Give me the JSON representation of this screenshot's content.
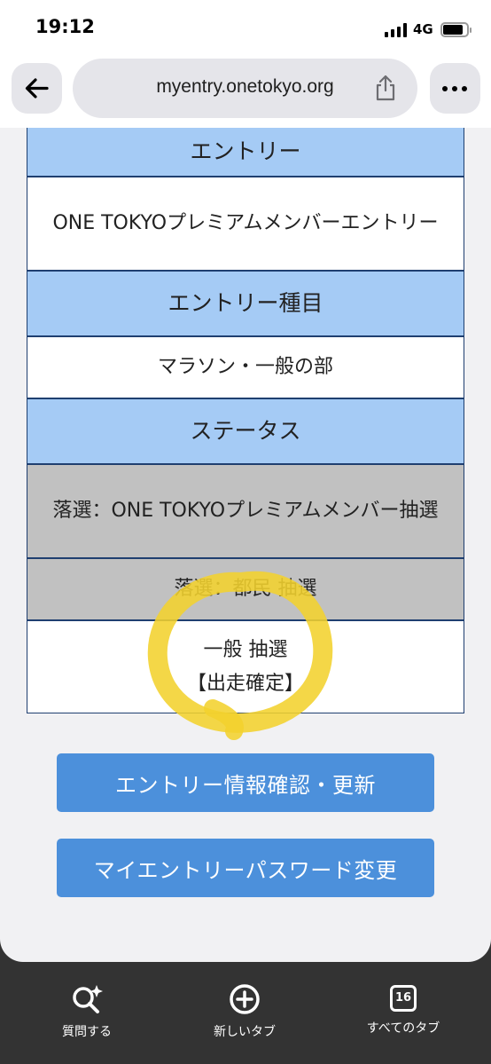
{
  "status_bar": {
    "time": "19:12",
    "network": "4G"
  },
  "browser": {
    "url": "myentry.onetokyo.org",
    "icons": [
      "back-arrow-icon",
      "share-icon",
      "more-icon"
    ]
  },
  "entry_table": {
    "entry_header": "エントリー",
    "entry_value": "ONE TOKYOプレミアムメンバーエントリー",
    "category_header": "エントリー種目",
    "category_value": "マラソン・一般の部",
    "status_header": "ステータス",
    "statuses": [
      {
        "text": "落選：ONE TOKYOプレミアムメンバー抽選"
      },
      {
        "text": "落選：都民 抽選"
      },
      {
        "line1": "一般 抽選",
        "line2": "【出走確定】"
      }
    ]
  },
  "annotation": {
    "highlight_color": "#f2d22e"
  },
  "buttons": {
    "entry_info": "エントリー情報確認・更新",
    "password_change": "マイエントリーパスワード変更"
  },
  "bottom_toolbar": {
    "ask_label": "質問する",
    "new_tab_label": "新しいタブ",
    "all_tabs_label": "すべてのタブ",
    "tab_count": "16"
  },
  "colors": {
    "header_blue": "#a5cbf5",
    "border_navy": "#1f3f70",
    "button_blue": "#4c90db",
    "lost_grey": "#c1c1c1"
  }
}
